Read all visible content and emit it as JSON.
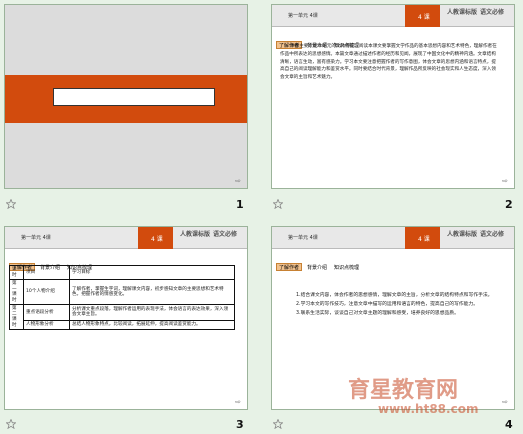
{
  "slides": [
    {
      "number": "1"
    },
    {
      "number": "2",
      "header": {
        "course": "第一单元 4课",
        "tag": "4 课",
        "logo_line1": "人教课标版",
        "logo_line2": "语文必修"
      },
      "tabs": [
        "了解作者",
        "背景介绍",
        "知识点梳理"
      ],
      "body": "本课主要介绍本单元的文体特征。阅读本课文要掌握文学作品的基本思想内容和艺术特色，理解作者在作品中所表达的思想感情。本篇文章通过描述作者的经历和见闻，展现了中国文化中的精神内涵。文章结构清晰，语言生动，富有感染力。学习本文要注意把握作者的写作意图，体会文章的思想内涵和语言特点，提高自己的阅读理解能力和鉴赏水平。同时要结合时代背景，理解作品所反映的社会现实和人生态度，深入领会文章的主旨和艺术魅力。"
    },
    {
      "number": "3",
      "header": {
        "course": "第一单元 4课",
        "tag": "4 课",
        "logo_line1": "人教课标版",
        "logo_line2": "语文必修"
      },
      "tabs": [
        "了解作者",
        "背景介绍",
        "知识点梳理"
      ],
      "table": [
        [
          "课时",
          "项目",
          "学习目标"
        ],
        [
          "第一课时",
          "10个人物介绍",
          "了解作者，掌握生字词，理解课文内容，初步感知文章的主要思想和艺术特色，把握作者的情感变化。"
        ],
        [
          "第二课时",
          "重点语段分析",
          "分析课文重点段落，理解作者运用的表现手法，体会语言的表达效果，深入领会文章主旨。"
        ],
        [
          "",
          "人物形象分析",
          "总结人物形象特点，比较阅读，拓展延伸，提高阅读鉴赏能力。"
        ]
      ]
    },
    {
      "number": "4",
      "header": {
        "course": "第一单元 4课",
        "tag": "4 课",
        "logo_line1": "人教课标版",
        "logo_line2": "语文必修"
      },
      "tabs": [
        "了解作者",
        "背景介绍",
        "知识点梳理"
      ],
      "paragraphs": [
        "1.结合课文内容，体会作者的思想感情，理解文章的主旨，分析文章的结构特点和写作手法。",
        "2.学习本文的写作技巧，注意文章中描写的运用和语言的特色，提高自己的写作能力。",
        "3.联系生活实际，谈谈自己对文章主题的理解和感受，培养良好的思想品质。"
      ]
    }
  ],
  "watermark": {
    "title": "育星教育网",
    "url": "www.ht88.com"
  },
  "colors": {
    "accent": "#d24b0d",
    "background": "#e7f2e6"
  }
}
